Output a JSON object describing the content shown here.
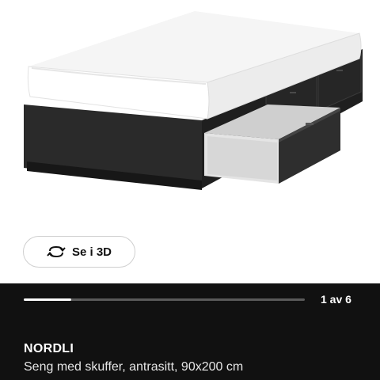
{
  "product_image": {
    "alt": "NORDLI bed with drawers",
    "colors": {
      "frame": "#2b2b2b",
      "mattress": "#f4f4f4",
      "drawer_interior": "#d9d9d9"
    }
  },
  "view_3d_button": {
    "label": "Se i 3D",
    "icon": "rotate-3d-icon"
  },
  "carousel": {
    "counter": "1 av 6",
    "progress_fraction": 0.17
  },
  "product": {
    "name": "NORDLI",
    "description": "Seng med skuffer, antrasitt, 90x200 cm"
  },
  "colors": {
    "panel_background": "#111111",
    "text_on_dark": "#ffffff"
  }
}
